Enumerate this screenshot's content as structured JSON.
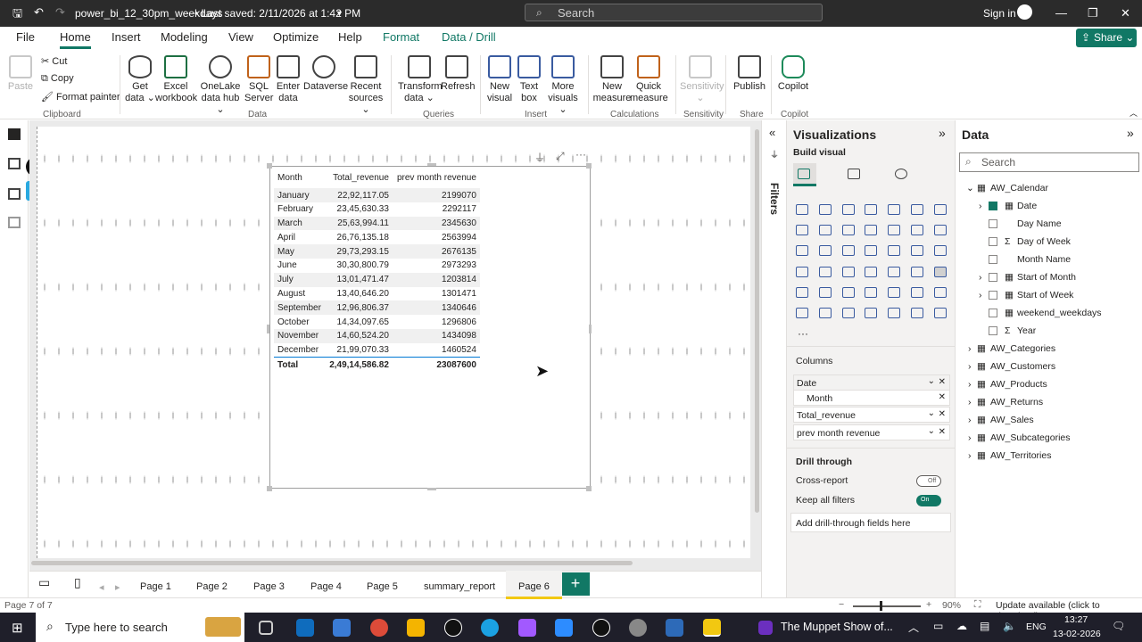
{
  "titlebar": {
    "file_name": "power_bi_12_30pm_weekdays",
    "save_status": "•  Last saved: 2/11/2026 at 1:42 PM",
    "search_placeholder": "Search",
    "sign_in": "Sign in"
  },
  "ribbon_tabs": [
    "File",
    "Home",
    "Insert",
    "Modeling",
    "View",
    "Optimize",
    "Help",
    "Format",
    "Data / Drill"
  ],
  "share_label": "Share",
  "ribbon": {
    "clipboard": {
      "paste": "Paste",
      "cut": "Cut",
      "copy": "Copy",
      "format_painter": "Format painter",
      "group": "Clipboard"
    },
    "data": {
      "get_data": "Get data ⌄",
      "excel": "Excel workbook",
      "onelake": "OneLake data hub ⌄",
      "sql": "SQL Server",
      "enter": "Enter data",
      "dataverse": "Dataverse",
      "recent": "Recent sources ⌄",
      "group": "Data"
    },
    "queries": {
      "transform": "Transform data ⌄",
      "refresh": "Refresh",
      "group": "Queries"
    },
    "insert": {
      "new_visual": "New visual",
      "text_box": "Text box",
      "more": "More visuals ⌄",
      "group": "Insert"
    },
    "calculations": {
      "new_measure": "New measure",
      "quick_measure": "Quick measure",
      "group": "Calculations"
    },
    "sensitivity": {
      "label": "Sensitivity ⌄",
      "group": "Sensitivity"
    },
    "share": {
      "publish": "Publish",
      "group": "Share"
    },
    "copilot": {
      "copilot": "Copilot",
      "group": "Copilot"
    }
  },
  "matrix": {
    "headers": [
      "Month",
      "Total_revenue",
      "prev month revenue"
    ],
    "rows": [
      [
        "January",
        "22,92,117.05",
        "2199070"
      ],
      [
        "February",
        "23,45,630.33",
        "2292117"
      ],
      [
        "March",
        "25,63,994.11",
        "2345630"
      ],
      [
        "April",
        "26,76,135.18",
        "2563994"
      ],
      [
        "May",
        "29,73,293.15",
        "2676135"
      ],
      [
        "June",
        "30,30,800.79",
        "2973293"
      ],
      [
        "July",
        "13,01,471.47",
        "1203814"
      ],
      [
        "August",
        "13,40,646.20",
        "1301471"
      ],
      [
        "September",
        "12,96,806.37",
        "1340646"
      ],
      [
        "October",
        "14,34,097.65",
        "1296806"
      ],
      [
        "November",
        "14,60,524.20",
        "1434098"
      ],
      [
        "December",
        "21,99,070.33",
        "1460524"
      ]
    ],
    "total": [
      "Total",
      "2,49,14,586.82",
      "23087600"
    ]
  },
  "page_tabs": [
    "Page 1",
    "Page 2",
    "Page 3",
    "Page 4",
    "Page 5",
    "summary_report",
    "Page 6"
  ],
  "active_page": "Page 6",
  "filters_label": "Filters",
  "viz_pane": {
    "title": "Visualizations",
    "build_visual": "Build visual",
    "columns_label": "Columns",
    "wells": [
      "Date",
      "Month",
      "Total_revenue",
      "prev month revenue"
    ],
    "drill_through": "Drill through",
    "cross_report": "Cross-report",
    "cross_report_state": "Off",
    "keep_all_filters": "Keep all filters",
    "keep_all_state": "On",
    "drill_placeholder": "Add drill-through fields here"
  },
  "data_pane": {
    "title": "Data",
    "search_placeholder": "Search",
    "tables": [
      "AW_Calendar",
      "AW_Categories",
      "AW_Customers",
      "AW_Products",
      "AW_Returns",
      "AW_Sales",
      "AW_Subcategories",
      "AW_Territories"
    ],
    "calendar_fields": [
      "Date",
      "Day Name",
      "Day of Week",
      "Month Name",
      "Start of Month",
      "Start of Week",
      "weekend_weekdays",
      "Year"
    ]
  },
  "status": {
    "page_info": "Page 7 of 7",
    "zoom": "90%",
    "update": "Update available (click to download)"
  },
  "taskbar": {
    "search": "Type here to search",
    "media": "The Muppet Show of...",
    "lang": "ENG",
    "time": "13:27",
    "date": "13-02-2026"
  }
}
